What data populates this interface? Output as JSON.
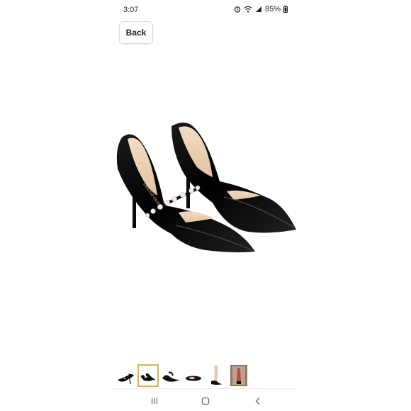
{
  "status_bar": {
    "time": "3:07",
    "battery_percent": "85%",
    "icons": [
      "alarm-icon",
      "wifi-icon",
      "signal-icon",
      "battery-icon"
    ]
  },
  "header": {
    "back_label": "Back"
  },
  "product": {
    "image_icon": "patent-leather-pearl-pump-shoes",
    "brand_stamp": "DREAM PAIRS"
  },
  "thumbnails": {
    "count": 6,
    "selected_index": 1,
    "selected_color": "#d8b45a"
  },
  "nav_bar": {
    "icons": [
      "recent-apps-icon",
      "home-icon",
      "back-nav-icon"
    ]
  }
}
